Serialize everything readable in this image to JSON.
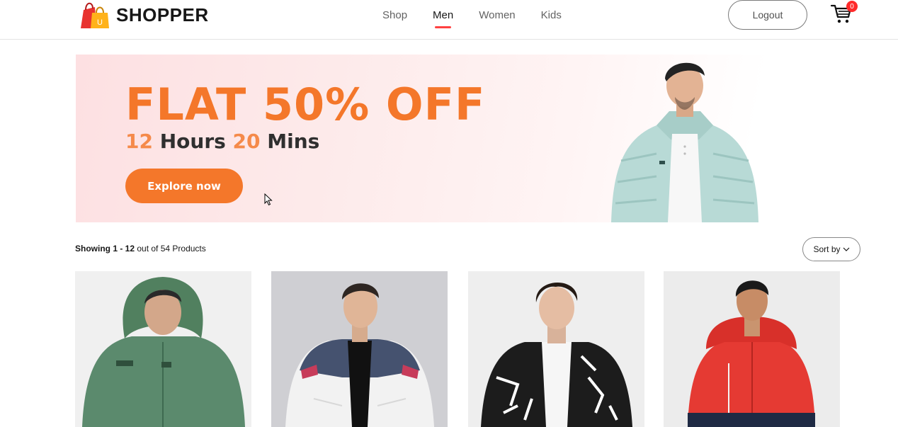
{
  "header": {
    "brand": "SHOPPER",
    "logo_badge": "U",
    "nav": [
      {
        "label": "Shop",
        "active": false
      },
      {
        "label": "Men",
        "active": true
      },
      {
        "label": "Women",
        "active": false
      },
      {
        "label": "Kids",
        "active": false
      }
    ],
    "logout_label": "Logout",
    "cart_count": "0"
  },
  "banner": {
    "headline": "FLAT 50% OFF",
    "hours_value": "12",
    "hours_label": "Hours",
    "mins_value": "20",
    "mins_label": "Mins",
    "cta_label": "Explore now"
  },
  "listing": {
    "showing_range": "Showing 1 - 12",
    "showing_rest": "out of 54 Products",
    "sort_label": "Sort by"
  },
  "products": [
    {
      "name": "green-zip-hoodie"
    },
    {
      "name": "colorblock-puffer-jacket"
    },
    {
      "name": "black-white-print-jacket"
    },
    {
      "name": "red-urban-active-jacket"
    }
  ],
  "colors": {
    "accent_orange": "#f4772a",
    "nav_underline": "#ff4141",
    "cart_badge": "#ff2a2a"
  }
}
